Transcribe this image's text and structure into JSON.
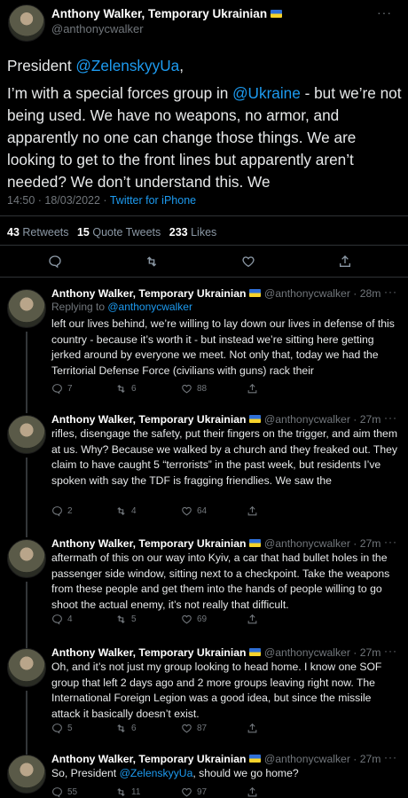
{
  "main_tweet": {
    "author_name": "Anthony Walker, Temporary Ukrainian",
    "author_handle": "@anthonycwalker",
    "more": "···",
    "text_line1_prefix": "President ",
    "text_line1_mention": "@ZelenskyyUa",
    "text_line1_suffix": ",",
    "text_p2_a": "I’m with a special forces group in ",
    "text_p2_mention": "@Ukraine",
    "text_p2_b": " - but we’re not being used. We have no weapons, no armor, and apparently no one can change those things. We are looking to get to the front lines but apparently aren’t needed? We don’t understand this. We",
    "time": "14:50 · 18/03/2022 · ",
    "source": "Twitter for iPhone",
    "retweets_count": "43",
    "retweets_label": "Retweets",
    "quotes_count": "15",
    "quotes_label": "Quote Tweets",
    "likes_count": "233",
    "likes_label": "Likes"
  },
  "replies": [
    {
      "name": "Anthony Walker, Temporary Ukrainian",
      "handle_time": "@anthonycwalker · 28m",
      "replying_prefix": "Replying to ",
      "replying_to": "@anthonycwalker",
      "text": "left our lives behind, we’re willing to lay down our lives in defense of this country - because it’s worth it -  but instead we’re sitting here getting jerked around by everyone we meet. Not only that, today we had the Territorial Defense Force (civilians with guns) rack their",
      "replies": "7",
      "retweets": "6",
      "likes": "88"
    },
    {
      "name": "Anthony Walker, Temporary Ukrainian",
      "handle_time": "@anthonycwalker · 27m",
      "text": "rifles, disengage the safety, put their fingers on the trigger, and aim them at us. Why? Because we walked by a church and they freaked out. They claim to have caught 5 “terrorists” in the past week, but residents I’ve spoken with say the TDF is fragging friendlies. We saw the",
      "replies": "2",
      "retweets": "4",
      "likes": "64"
    },
    {
      "name": "Anthony Walker, Temporary Ukrainian",
      "handle_time": "@anthonycwalker · 27m",
      "text": "aftermath of this on our way into Kyiv, a car that had bullet holes in the passenger side window, sitting next to a checkpoint. Take the weapons from these people and get them into the hands of people willing to go shoot the actual enemy, it’s not really that difficult.",
      "replies": "4",
      "retweets": "5",
      "likes": "69"
    },
    {
      "name": "Anthony Walker, Temporary Ukrainian",
      "handle_time": "@anthonycwalker · 27m",
      "text": "Oh, and it’s not just my group looking to head home. I know one SOF group that left 2 days ago and 2 more groups leaving right now. The International Foreign Legion was a good idea, but since the missile attack it basically doesn’t exist.",
      "replies": "5",
      "retweets": "6",
      "likes": "87"
    },
    {
      "name": "Anthony Walker, Temporary Ukrainian",
      "handle_time": "@anthonycwalker · 27m",
      "text_prefix": "So, President ",
      "text_mention": "@ZelenskyyUa",
      "text_suffix": ", should we go home?",
      "replies": "55",
      "retweets": "11",
      "likes": "97"
    }
  ],
  "colors": {
    "background": "#000000",
    "accent": "#1d9bf0",
    "muted": "#71767b"
  }
}
